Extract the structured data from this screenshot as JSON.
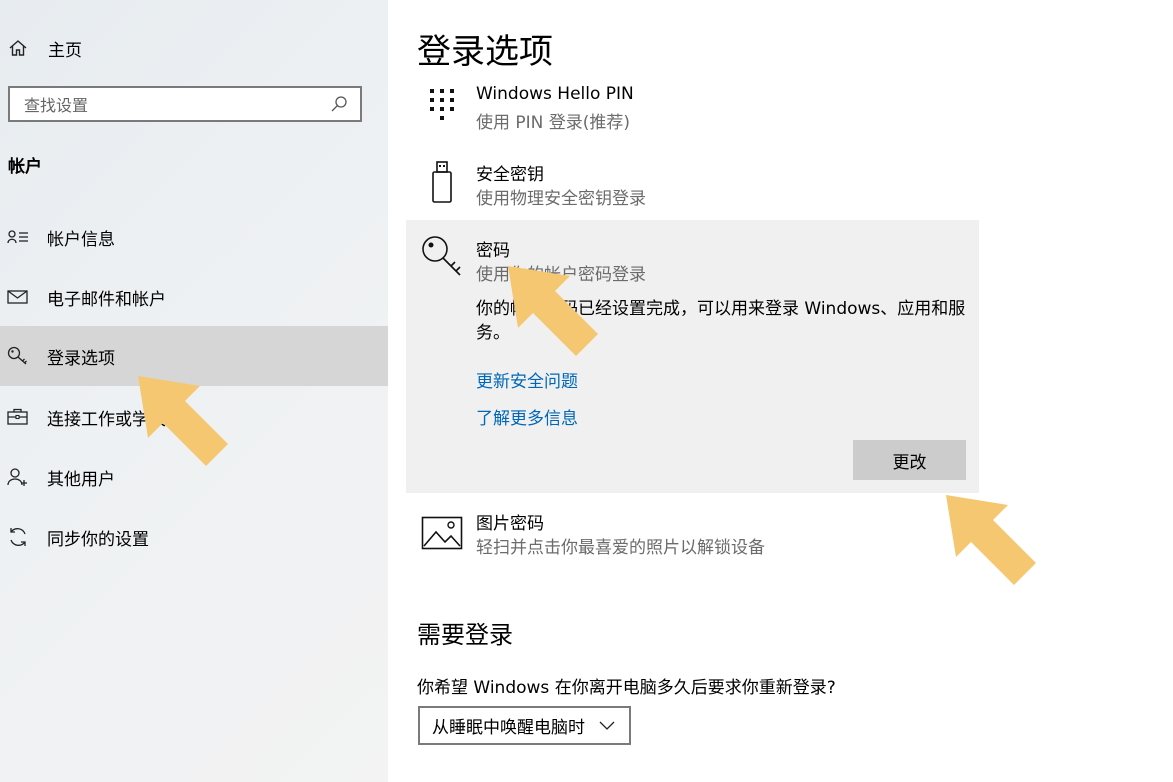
{
  "sidebar": {
    "home_label": "主页",
    "search_placeholder": "查找设置",
    "section_title": "帐户",
    "items": [
      {
        "label": "帐户信息",
        "icon": "account-info-icon"
      },
      {
        "label": "电子邮件和帐户",
        "icon": "mail-icon"
      },
      {
        "label": "登录选项",
        "icon": "key-icon",
        "selected": true
      },
      {
        "label": "连接工作或学校帐户",
        "icon": "briefcase-icon"
      },
      {
        "label": "其他用户",
        "icon": "add-person-icon"
      },
      {
        "label": "同步你的设置",
        "icon": "sync-icon"
      }
    ]
  },
  "main": {
    "title": "登录选项",
    "options": [
      {
        "title": "Windows Hello PIN",
        "subtitle": "使用 PIN 登录(推荐)",
        "icon": "pin-keypad-icon"
      },
      {
        "title": "安全密钥",
        "subtitle": "使用物理安全密钥登录",
        "icon": "usb-key-icon"
      },
      {
        "title": "密码",
        "subtitle": "使用你的帐户密码登录",
        "icon": "password-key-icon",
        "description": "你的帐户密码已经设置完成，可以用来登录 Windows、应用和服务。",
        "links": [
          "更新安全问题",
          "了解更多信息"
        ],
        "button_label": "更改"
      },
      {
        "title": "图片密码",
        "subtitle": "轻扫并点击你最喜爱的照片以解锁设备",
        "icon": "picture-icon"
      }
    ],
    "require_signin": {
      "heading": "需要登录",
      "question": "你希望 Windows 在你离开电脑多久后要求你重新登录?",
      "dropdown_value": "从睡眠中唤醒电脑时"
    }
  },
  "colors": {
    "accent_link": "#0067b8",
    "annotation_arrow": "#f5c770",
    "selected_background": "#d6d6d6"
  }
}
